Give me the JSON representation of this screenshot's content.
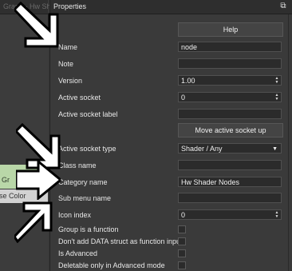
{
  "left_panel": {
    "title": "Graph - Hw Sh",
    "node_group": "Gr",
    "node_use_color": "use Color"
  },
  "properties": {
    "title": "Properties",
    "float_icon": "dock-float-icon",
    "help_label": "Help",
    "rows": {
      "name": {
        "label": "Name",
        "value": "node"
      },
      "note": {
        "label": "Note",
        "value": ""
      },
      "version": {
        "label": "Version",
        "value": "1.00"
      },
      "active_socket": {
        "label": "Active socket",
        "value": "0"
      },
      "active_socket_label": {
        "label": "Active socket label",
        "value": ""
      },
      "move_button": "Move active socket up",
      "active_socket_type": {
        "label": "Active socket type",
        "value": "Shader / Any"
      },
      "class_name": {
        "label": "Class name",
        "value": ""
      },
      "category_name": {
        "label": "Category name",
        "value": "Hw Shader Nodes"
      },
      "sub_menu_name": {
        "label": "Sub menu name",
        "value": ""
      },
      "icon_index": {
        "label": "Icon index",
        "value": "0"
      },
      "group_is_function": {
        "label": "Group is a function",
        "checked": false
      },
      "dont_add_data": {
        "label": "Don't add DATA struct as function inpu",
        "checked": false
      },
      "is_advanced": {
        "label": "Is Advanced",
        "checked": false
      },
      "deletable_only": {
        "label": "Deletable only in Advanced mode",
        "checked": false
      }
    }
  }
}
